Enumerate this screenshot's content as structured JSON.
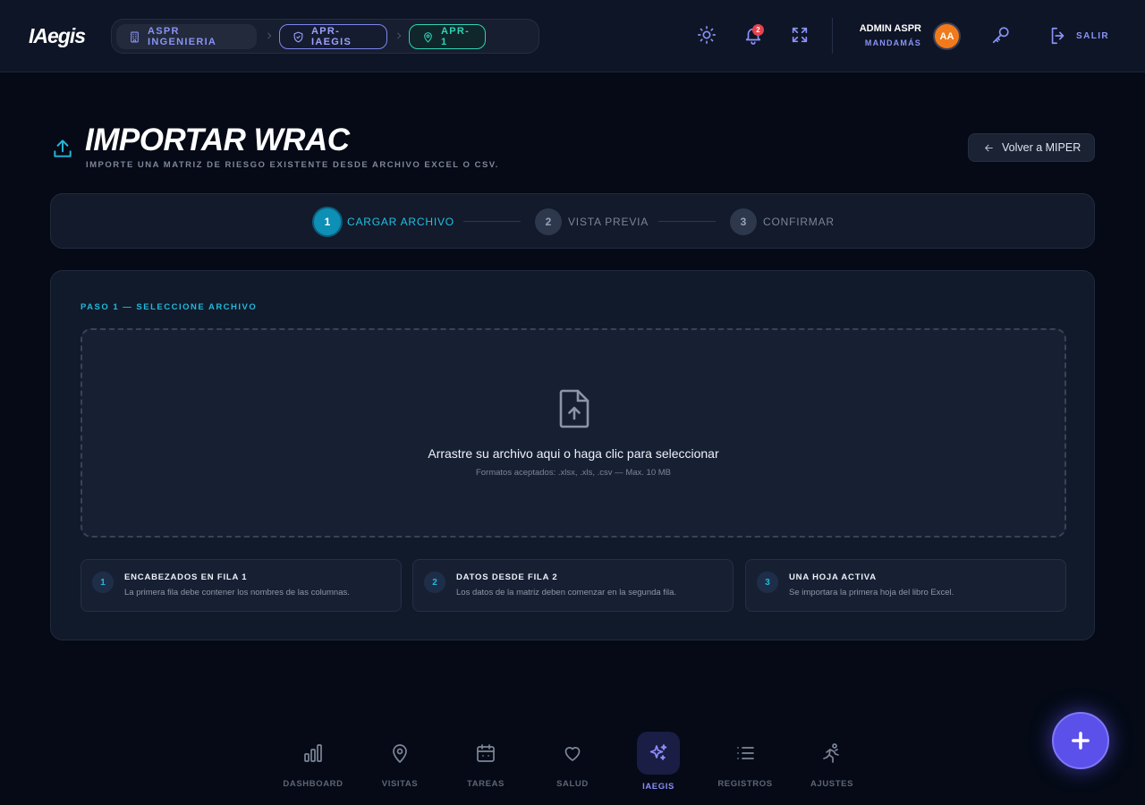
{
  "app": {
    "logo": "IAegis"
  },
  "breadcrumbs": [
    {
      "label": "ASPR INGENIERIA",
      "icon": "building-icon"
    },
    {
      "label": "APR-IAEGIS",
      "icon": "shield-icon"
    },
    {
      "label": "APR-1",
      "icon": "location-pin-icon"
    }
  ],
  "header": {
    "notifications_count": "2",
    "user": {
      "name": "ADMIN ASPR",
      "role": "MANDAMÁS",
      "initials": "AA"
    },
    "logout_label": "SALIR"
  },
  "page": {
    "title": "IMPORTAR WRAC",
    "subtitle": "IMPORTE UNA MATRIZ DE RIESGO EXISTENTE DESDE ARCHIVO EXCEL O CSV.",
    "back_button": "Volver a MIPER"
  },
  "stepper": [
    {
      "number": "1",
      "label": "CARGAR ARCHIVO",
      "active": true
    },
    {
      "number": "2",
      "label": "VISTA PREVIA",
      "active": false
    },
    {
      "number": "3",
      "label": "CONFIRMAR",
      "active": false
    }
  ],
  "upload": {
    "heading": "PASO 1 — SELECCIONE ARCHIVO",
    "drop_text": "Arrastre su archivo aqui o haga clic para seleccionar",
    "formats_text": "Formatos aceptados: .xlsx, .xls, .csv — Max. 10 MB"
  },
  "instructions": [
    {
      "number": "1",
      "title": "ENCABEZADOS EN FILA 1",
      "description": "La primera fila debe contener los nombres de las columnas."
    },
    {
      "number": "2",
      "title": "DATOS DESDE FILA 2",
      "description": "Los datos de la matriz deben comenzar en la segunda fila."
    },
    {
      "number": "3",
      "title": "UNA HOJA ACTIVA",
      "description": "Se importara la primera hoja del libro Excel."
    }
  ],
  "bottom_nav": [
    {
      "label": "DASHBOARD",
      "icon": "bar-chart-icon",
      "active": false
    },
    {
      "label": "VISITAS",
      "icon": "location-pin-icon",
      "active": false
    },
    {
      "label": "TAREAS",
      "icon": "calendar-icon",
      "active": false
    },
    {
      "label": "SALUD",
      "icon": "heart-icon",
      "active": false
    },
    {
      "label": "IAEGIS",
      "icon": "sparkles-icon",
      "active": true
    },
    {
      "label": "REGISTROS",
      "icon": "list-icon",
      "active": false
    },
    {
      "label": "AJUSTES",
      "icon": "person-running-icon",
      "active": false
    }
  ],
  "colors": {
    "background": "#050a16",
    "accent": "#22b8d9",
    "brand_indigo": "#8a93f6",
    "fab": "#5b50ea",
    "breadcrumb_active": "#2fd3b4",
    "avatar": "#f27a1a",
    "badge": "#e5424d"
  }
}
